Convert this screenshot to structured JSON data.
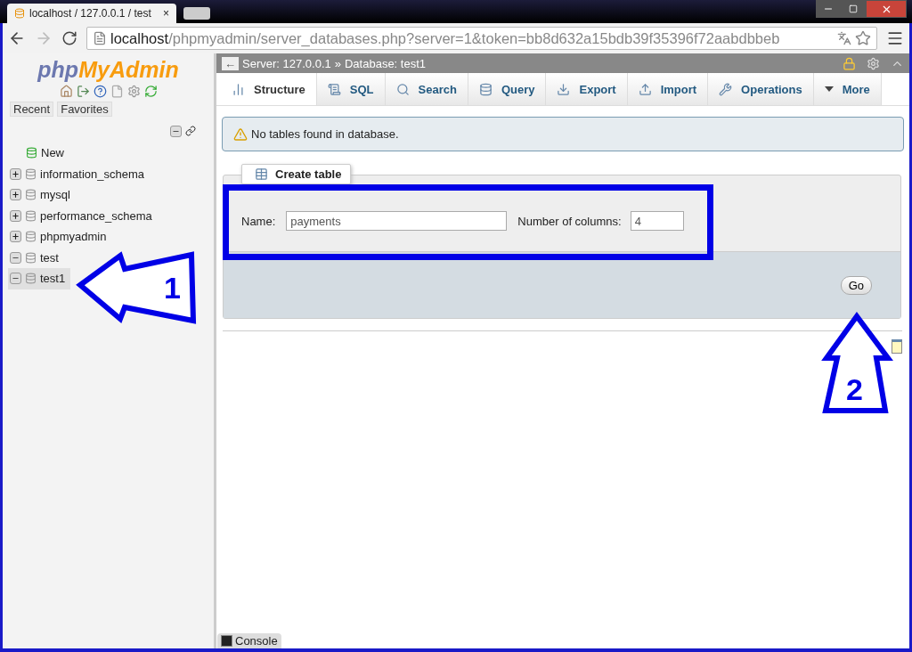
{
  "browser": {
    "tab_title": "localhost / 127.0.0.1 / test",
    "tab_close": "×",
    "url_host": "localhost",
    "url_path": "/phpmyadmin/server_databases.php?server=1&token=bb8d632a15bdb39f35396f72aabdbbeb"
  },
  "sidebar": {
    "logo_prefix": "php",
    "logo_name": "MyAdmin",
    "buttons": [
      "Recent",
      "Favorites"
    ],
    "tree": [
      {
        "kind": "new",
        "label": "New",
        "selected": false
      },
      {
        "kind": "db",
        "label": "information_schema",
        "expanded": false,
        "selected": false
      },
      {
        "kind": "db",
        "label": "mysql",
        "expanded": false,
        "selected": false
      },
      {
        "kind": "db",
        "label": "performance_schema",
        "expanded": false,
        "selected": false
      },
      {
        "kind": "db",
        "label": "phpmyadmin",
        "expanded": false,
        "selected": false
      },
      {
        "kind": "db",
        "label": "test",
        "expanded": true,
        "selected": false
      },
      {
        "kind": "db",
        "label": "test1",
        "expanded": true,
        "selected": true
      }
    ]
  },
  "breadcrumb": {
    "back": "←",
    "server": "Server: 127.0.0.1",
    "separator": "»",
    "database": "Database: test1"
  },
  "tabs": [
    {
      "label": "Structure",
      "selected": true
    },
    {
      "label": "SQL",
      "selected": false
    },
    {
      "label": "Search",
      "selected": false
    },
    {
      "label": "Query",
      "selected": false
    },
    {
      "label": "Export",
      "selected": false
    },
    {
      "label": "Import",
      "selected": false
    },
    {
      "label": "Operations",
      "selected": false
    },
    {
      "label": "More",
      "selected": false
    }
  ],
  "notice": "No tables found in database.",
  "create_table": {
    "legend": "Create table",
    "name_label": "Name:",
    "name_value": "payments",
    "columns_label": "Number of columns:",
    "columns_value": "4",
    "submit": "Go"
  },
  "console": "Console",
  "annotations": [
    "1",
    "2"
  ]
}
